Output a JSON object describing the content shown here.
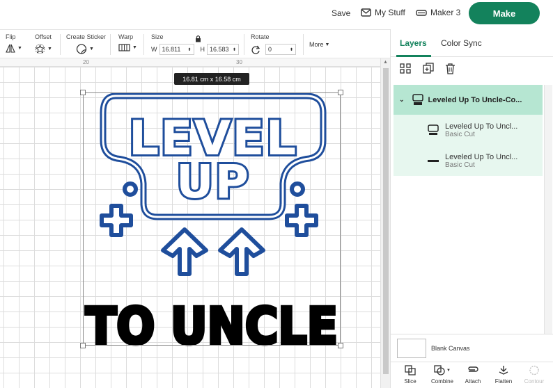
{
  "header": {
    "save_label": "Save",
    "mystuff_label": "My Stuff",
    "maker_label": "Maker 3",
    "make_label": "Make"
  },
  "toolbar": {
    "flip_label": "Flip",
    "offset_label": "Offset",
    "sticker_label": "Create Sticker",
    "warp_label": "Warp",
    "size_label": "Size",
    "w_label": "W",
    "w_value": "16.811",
    "h_label": "H",
    "h_value": "16.583",
    "rotate_label": "Rotate",
    "rotate_value": "0",
    "more_label": "More"
  },
  "ruler": {
    "mark1": "20",
    "mark2": "30"
  },
  "canvas": {
    "size_tooltip": "16.81  cm x 16.58  cm",
    "design_text_top": "LEVEL",
    "design_text_mid": "UP",
    "design_text_bottom": "TO UNCLE"
  },
  "panel": {
    "tabs": [
      {
        "label": "Layers"
      },
      {
        "label": "Color Sync"
      }
    ],
    "group": {
      "label": "Leveled Up To Uncle-Co..."
    },
    "layers": [
      {
        "name": "Leveled Up To Uncl...",
        "op": "Basic Cut"
      },
      {
        "name": "Leveled Up To Uncl...",
        "op": "Basic Cut"
      }
    ],
    "blank_canvas_label": "Blank Canvas",
    "bottom_tools": [
      {
        "label": "Slice"
      },
      {
        "label": "Combine"
      },
      {
        "label": "Attach"
      },
      {
        "label": "Flatten"
      },
      {
        "label": "Contour"
      }
    ]
  },
  "colors": {
    "accent": "#13825c",
    "design_blue": "#1f4e9c",
    "layer_selected": "#b6e6d2"
  }
}
